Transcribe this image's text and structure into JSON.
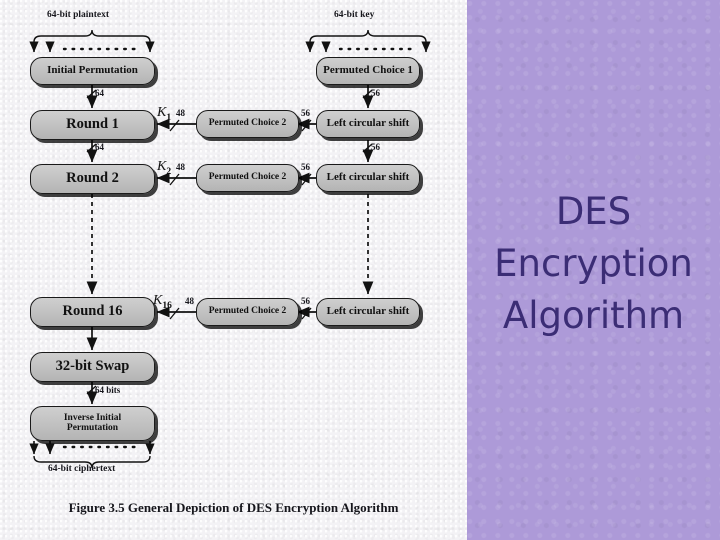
{
  "slide": {
    "title_lines": "DES\nEncryption\nAlgorithm",
    "accent_color": "#ad9ad8",
    "title_color": "#3b2d75",
    "figure_bg": "#f3f2f5"
  },
  "figure": {
    "caption": "Figure 3.5  General Depiction of DES Encryption Algorithm",
    "input_label_left": "64-bit plaintext",
    "input_label_right": "64-bit key",
    "output_label": "64-bit ciphertext",
    "nodes": {
      "initial_permutation": "Initial Permutation",
      "round1": "Round 1",
      "round2": "Round 2",
      "round16": "Round 16",
      "swap": "32-bit Swap",
      "inverse_initial_permutation": "Inverse Initial\nPermutation",
      "permuted_choice_1": "Permuted Choice 1",
      "permuted_choice_2_a": "Permuted Choice 2",
      "permuted_choice_2_b": "Permuted Choice 2",
      "permuted_choice_2_c": "Permuted Choice 2",
      "left_circular_shift_a": "Left circular shift",
      "left_circular_shift_b": "Left circular shift",
      "left_circular_shift_c": "Left circular shift"
    },
    "subkeys": {
      "k1": "K",
      "k1sub": "1",
      "k2": "K",
      "k2sub": "2",
      "k16": "K",
      "k16sub": "16"
    },
    "bit_labels": {
      "ip_out": "64",
      "r1_out": "64",
      "pc1_out": "56",
      "ls1_out": "56",
      "pc2a_in": "56",
      "pc2b_in": "56",
      "pc2c_in": "56",
      "k1_width": "48",
      "k2_width": "48",
      "k16_width": "48",
      "swap_out": "64 bits"
    }
  }
}
